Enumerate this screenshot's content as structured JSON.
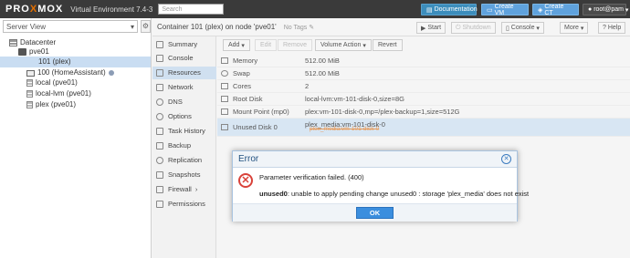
{
  "topbar": {
    "logo_pro": "PRO",
    "logo_x": "X",
    "logo_mox": "MOX",
    "version": "Virtual Environment 7.4-3",
    "search_placeholder": "Search",
    "doc_label": "Documentation",
    "create_vm_label": "Create VM",
    "create_ct_label": "Create CT",
    "user_label": "root@pam"
  },
  "tree": {
    "view_label": "Server View",
    "items": [
      {
        "label": "Datacenter"
      },
      {
        "label": "pve01"
      },
      {
        "label": "101 (plex)"
      },
      {
        "label": "100 (HomeAssistant)"
      },
      {
        "label": "local (pve01)"
      },
      {
        "label": "local-lvm (pve01)"
      },
      {
        "label": "plex (pve01)"
      }
    ]
  },
  "header": {
    "title": "Container 101 (plex) on node 'pve01'",
    "tags": "No Tags",
    "start": "Start",
    "shutdown": "Shutdown",
    "console": "Console",
    "more": "More",
    "help": "Help"
  },
  "nav": {
    "items": [
      {
        "label": "Summary"
      },
      {
        "label": "Console"
      },
      {
        "label": "Resources"
      },
      {
        "label": "Network"
      },
      {
        "label": "DNS"
      },
      {
        "label": "Options"
      },
      {
        "label": "Task History"
      },
      {
        "label": "Backup"
      },
      {
        "label": "Replication"
      },
      {
        "label": "Snapshots"
      },
      {
        "label": "Firewall"
      },
      {
        "label": "Permissions"
      }
    ]
  },
  "toolbar": {
    "add": "Add",
    "edit": "Edit",
    "remove": "Remove",
    "volume_action": "Volume Action",
    "revert": "Revert"
  },
  "resources": [
    {
      "key": "Memory",
      "value": "512.00 MiB"
    },
    {
      "key": "Swap",
      "value": "512.00 MiB"
    },
    {
      "key": "Cores",
      "value": "2"
    },
    {
      "key": "Root Disk",
      "value": "local-lvm:vm-101-disk-0,size=8G"
    },
    {
      "key": "Mount Point (mp0)",
      "value": "plex:vm-101-disk-0,mp=/plex-backup=1,size=512G"
    },
    {
      "key": "Unused Disk 0",
      "value": "plex_media:vm-101-disk-0"
    }
  ],
  "pending_value": "plex_media:vm-101-disk-0",
  "dialog": {
    "title": "Error",
    "line1": "Parameter verification failed. (400)",
    "line2_bold": "unused0",
    "line2_rest": ": unable to apply pending change unused0 : storage 'plex_media' does not exist",
    "ok": "OK"
  },
  "colors": {
    "topbar": "#3a3a3a",
    "accent": "#3b8ede",
    "error": "#d9423a",
    "selection": "#c9ddf2"
  }
}
